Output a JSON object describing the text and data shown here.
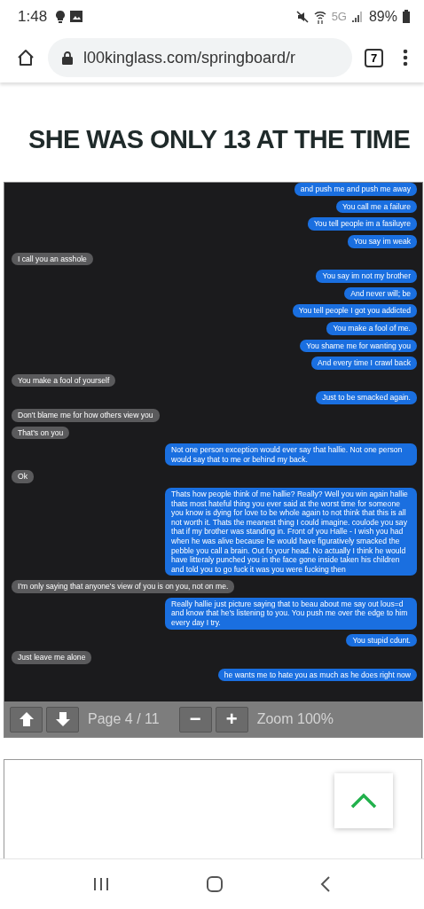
{
  "status_bar": {
    "time": "1:48",
    "network": "5G",
    "battery": "89%"
  },
  "browser": {
    "url": "l00kinglass.com/springboard/r",
    "tab_count": "7"
  },
  "headline": "SHE WAS ONLY 13 AT THE TIME",
  "chat": {
    "messages": [
      {
        "kind": "sent",
        "text": "and push me and push me away"
      },
      {
        "kind": "sent",
        "text": "You call me a failure"
      },
      {
        "kind": "sent",
        "text": "You tell people im a fasiluyre"
      },
      {
        "kind": "sent",
        "text": "You say im weak"
      },
      {
        "kind": "received",
        "text": "I call you an asshole"
      },
      {
        "kind": "sent",
        "text": "You say im not my brother"
      },
      {
        "kind": "sent",
        "text": "And never will; be"
      },
      {
        "kind": "sent",
        "text": "You tell people I got you addicted"
      },
      {
        "kind": "sent",
        "text": "You make a fool of me."
      },
      {
        "kind": "sent",
        "text": "You shame me for wanting you"
      },
      {
        "kind": "sent",
        "text": "And every time I crawl back"
      },
      {
        "kind": "received",
        "text": "You make a fool of yourself"
      },
      {
        "kind": "sent",
        "text": "Just to be smacked again."
      },
      {
        "kind": "received",
        "text": "Don't blame me for how others view you"
      },
      {
        "kind": "received",
        "text": "That's on you"
      },
      {
        "kind": "sent",
        "text": "Not one person exception would ever say that hallie.  Not one person would say that to me or behind my back."
      },
      {
        "kind": "received",
        "text": "Ok"
      },
      {
        "kind": "sent",
        "text": "Thats how people think of me hallie? Really?  Well you win again hallie thats most hateful thing you ever said at the worst time for someone you know is dying for love to be whole again to not think that this is all not worth it.  Thats the meanest thing I could imagine.  coulode you say that if my brother was standing in. Front of  you Halle -  I wish you had when he was alive because he would have figuratively smacked the pebble you call a brain. Out fo your head. No actually I think he would have litteraly punched you in the face gone inside taken his children and told you to go fuck it was you were fucking then"
      },
      {
        "kind": "received",
        "text": "I'm only saying that anyone's view of you is on you, not on me."
      },
      {
        "kind": "sent",
        "text": "Really hallie just picture saying that to beau about me say out lous=d and know that he's listening to you.  You push me over the edge to him every day I try."
      },
      {
        "kind": "sent",
        "text": "You stupid cdunt."
      },
      {
        "kind": "received",
        "text": "Just leave me alone"
      },
      {
        "kind": "sent",
        "text": "he wants me to hate you as much as he does right now"
      }
    ],
    "toolbar": {
      "page": "Page 4 / 11",
      "minus": "−",
      "plus": "+",
      "zoom": "Zoom 100%"
    }
  }
}
